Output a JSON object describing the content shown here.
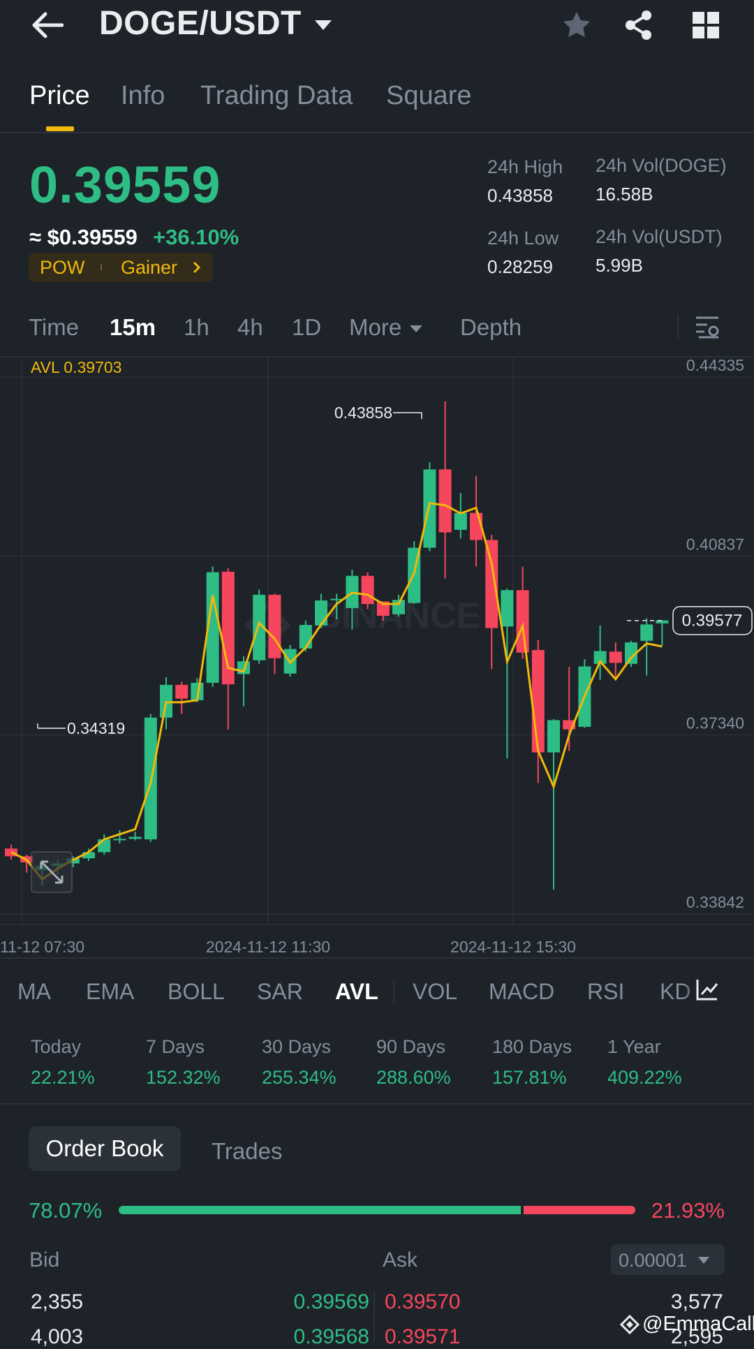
{
  "header": {
    "pair": "DOGE/USDT",
    "icons": [
      "back-arrow-icon",
      "dropdown-caret-icon",
      "star-icon",
      "share-icon",
      "grid-icon"
    ]
  },
  "tabs": [
    "Price",
    "Info",
    "Trading Data",
    "Square"
  ],
  "price": {
    "last": "0.39559",
    "approx": "≈ $0.39559",
    "change": "+36.10%",
    "tag1": "POW",
    "tag2": "Gainer",
    "high_label": "24h High",
    "high": "0.43858",
    "low_label": "24h Low",
    "low": "0.28259",
    "vol_doge_label": "24h Vol(DOGE)",
    "vol_doge": "16.58B",
    "vol_usdt_label": "24h Vol(USDT)",
    "vol_usdt": "5.99B"
  },
  "intervals": {
    "time": "Time",
    "m15": "15m",
    "h1": "1h",
    "h4": "4h",
    "d1": "1D",
    "more": "More",
    "depth": "Depth"
  },
  "chart_data": {
    "type": "candlestick",
    "avl_label": "AVL 0.39703",
    "y_ticks": [
      "0.44335",
      "0.40837",
      "0.37340",
      "0.33842"
    ],
    "ylim": [
      0.33842,
      0.44335
    ],
    "x_ticks": [
      "11-12 07:30",
      "2024-11-12 11:30",
      "2024-11-12 15:30"
    ],
    "max_label": "0.43858",
    "min_label": "0.34319",
    "current_price_label": "0.39577",
    "watermark": "BINANCE",
    "candles": [
      {
        "o": 0.3512,
        "c": 0.3497,
        "h": 0.352,
        "l": 0.349
      },
      {
        "o": 0.3497,
        "c": 0.3485,
        "h": 0.35,
        "l": 0.3465
      },
      {
        "o": 0.347,
        "c": 0.3478,
        "h": 0.3485,
        "l": 0.344
      },
      {
        "o": 0.3478,
        "c": 0.3483,
        "h": 0.349,
        "l": 0.3462
      },
      {
        "o": 0.3483,
        "c": 0.3493,
        "h": 0.3497,
        "l": 0.3476
      },
      {
        "o": 0.3493,
        "c": 0.3505,
        "h": 0.3512,
        "l": 0.3488
      },
      {
        "o": 0.3505,
        "c": 0.353,
        "h": 0.354,
        "l": 0.35
      },
      {
        "o": 0.353,
        "c": 0.3531,
        "h": 0.3548,
        "l": 0.3522
      },
      {
        "o": 0.3531,
        "c": 0.3535,
        "h": 0.3545,
        "l": 0.3528
      },
      {
        "o": 0.353,
        "c": 0.3768,
        "h": 0.3775,
        "l": 0.3525
      },
      {
        "o": 0.3768,
        "c": 0.3832,
        "h": 0.3847,
        "l": 0.3745
      },
      {
        "o": 0.3832,
        "c": 0.3805,
        "h": 0.3838,
        "l": 0.3775
      },
      {
        "o": 0.3802,
        "c": 0.3836,
        "h": 0.3845,
        "l": 0.3798
      },
      {
        "o": 0.3836,
        "c": 0.4052,
        "h": 0.4063,
        "l": 0.3828
      },
      {
        "o": 0.4053,
        "c": 0.3833,
        "h": 0.406,
        "l": 0.3745
      },
      {
        "o": 0.3853,
        "c": 0.3878,
        "h": 0.3888,
        "l": 0.379
      },
      {
        "o": 0.388,
        "c": 0.4008,
        "h": 0.4018,
        "l": 0.3873
      },
      {
        "o": 0.4008,
        "c": 0.3884,
        "h": 0.401,
        "l": 0.3853
      },
      {
        "o": 0.3854,
        "c": 0.3902,
        "h": 0.391,
        "l": 0.3848
      },
      {
        "o": 0.3903,
        "c": 0.3949,
        "h": 0.3958,
        "l": 0.3897
      },
      {
        "o": 0.3948,
        "c": 0.3997,
        "h": 0.401,
        "l": 0.3943
      },
      {
        "o": 0.3998,
        "c": 0.4,
        "h": 0.401,
        "l": 0.396
      },
      {
        "o": 0.3982,
        "c": 0.4045,
        "h": 0.4057,
        "l": 0.394
      },
      {
        "o": 0.4045,
        "c": 0.399,
        "h": 0.4052,
        "l": 0.398
      },
      {
        "o": 0.3995,
        "c": 0.3967,
        "h": 0.3995,
        "l": 0.3957
      },
      {
        "o": 0.397,
        "c": 0.3998,
        "h": 0.4008,
        "l": 0.3965
      },
      {
        "o": 0.3992,
        "c": 0.41,
        "h": 0.4113,
        "l": 0.399
      },
      {
        "o": 0.41,
        "c": 0.4253,
        "h": 0.4267,
        "l": 0.4093
      },
      {
        "o": 0.4253,
        "c": 0.413,
        "h": 0.4386,
        "l": 0.404
      },
      {
        "o": 0.4135,
        "c": 0.4168,
        "h": 0.4207,
        "l": 0.4118
      },
      {
        "o": 0.4168,
        "c": 0.4115,
        "h": 0.424,
        "l": 0.4063
      },
      {
        "o": 0.4115,
        "c": 0.3943,
        "h": 0.4125,
        "l": 0.3863
      },
      {
        "o": 0.3946,
        "c": 0.4017,
        "h": 0.402,
        "l": 0.3688
      },
      {
        "o": 0.4017,
        "c": 0.3895,
        "h": 0.4063,
        "l": 0.3883
      },
      {
        "o": 0.39,
        "c": 0.37,
        "h": 0.392,
        "l": 0.364
      },
      {
        "o": 0.37,
        "c": 0.3763,
        "h": 0.3765,
        "l": 0.3432
      },
      {
        "o": 0.3763,
        "c": 0.3745,
        "h": 0.3867,
        "l": 0.3703
      },
      {
        "o": 0.375,
        "c": 0.3868,
        "h": 0.3882,
        "l": 0.3748
      },
      {
        "o": 0.3873,
        "c": 0.3898,
        "h": 0.3948,
        "l": 0.3842
      },
      {
        "o": 0.3897,
        "c": 0.3875,
        "h": 0.3915,
        "l": 0.3845
      },
      {
        "o": 0.3873,
        "c": 0.3915,
        "h": 0.3918,
        "l": 0.3867
      },
      {
        "o": 0.3918,
        "c": 0.395,
        "h": 0.3962,
        "l": 0.385
      },
      {
        "o": 0.3952,
        "c": 0.3958,
        "h": 0.3952,
        "l": 0.3908
      }
    ],
    "avl_line": [
      0.3505,
      0.349,
      0.3452,
      0.3473,
      0.349,
      0.3505,
      0.353,
      0.354,
      0.355,
      0.364,
      0.3798,
      0.3798,
      0.3802,
      0.4007,
      0.3865,
      0.3858,
      0.3953,
      0.3922,
      0.3875,
      0.3905,
      0.395,
      0.399,
      0.4012,
      0.4008,
      0.399,
      0.399,
      0.405,
      0.4187,
      0.4183,
      0.4167,
      0.4178,
      0.407,
      0.3877,
      0.3947,
      0.3703,
      0.3633,
      0.3734,
      0.381,
      0.3878,
      0.3843,
      0.3885,
      0.3913,
      0.3907
    ]
  },
  "indicators": [
    "MA",
    "EMA",
    "BOLL",
    "SAR",
    "AVL",
    "VOL",
    "MACD",
    "RSI",
    "KD"
  ],
  "performance": [
    {
      "label": "Today",
      "value": "22.21%"
    },
    {
      "label": "7 Days",
      "value": "152.32%"
    },
    {
      "label": "30 Days",
      "value": "255.34%"
    },
    {
      "label": "90 Days",
      "value": "288.60%"
    },
    {
      "label": "180 Days",
      "value": "157.81%"
    },
    {
      "label": "1 Year",
      "value": "409.22%"
    }
  ],
  "orderbook": {
    "tab_active": "Order Book",
    "tab_trades": "Trades",
    "bid_pct": "78.07%",
    "ask_pct": "21.93%",
    "bid_ratio": 0.7807,
    "bid_label": "Bid",
    "ask_label": "Ask",
    "precision": "0.00001",
    "rows": [
      {
        "bid_qty": "2,355",
        "bid_price": "0.39569",
        "ask_price": "0.39570",
        "ask_qty": "3,577"
      },
      {
        "bid_qty": "4,003",
        "bid_price": "0.39568",
        "ask_price": "0.39571",
        "ask_qty": "2,595"
      }
    ]
  },
  "watermark_user": "@EmmaCalls"
}
